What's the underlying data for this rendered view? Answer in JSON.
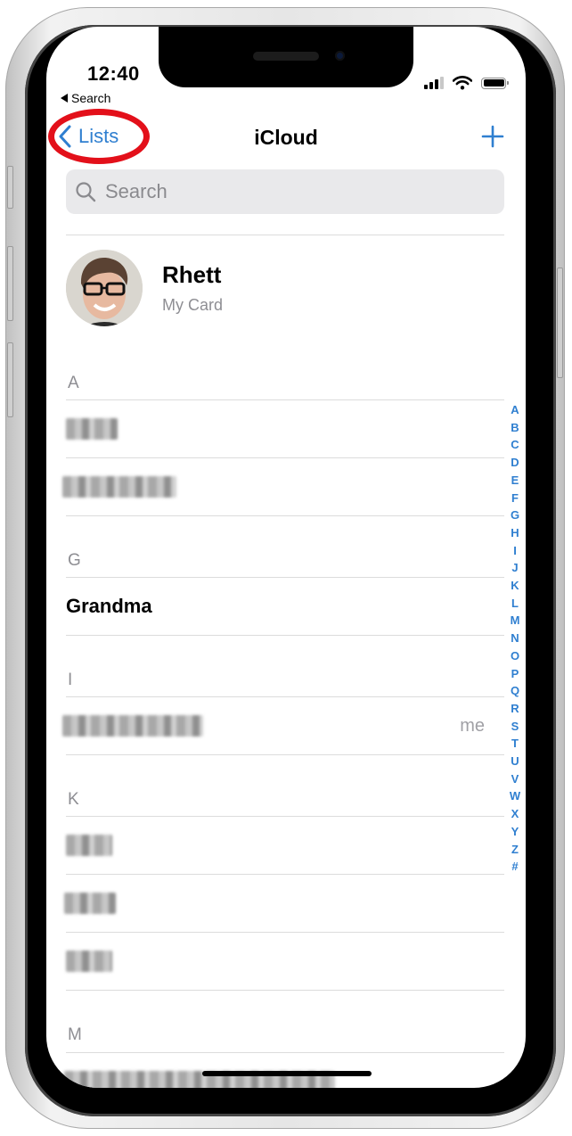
{
  "status_bar": {
    "time": "12:40",
    "back_app": "Search",
    "icons": [
      "cellular-signal-icon",
      "wifi-icon",
      "battery-icon"
    ]
  },
  "nav": {
    "back_label": "Lists",
    "title": "iCloud",
    "add_icon": "plus-icon"
  },
  "search": {
    "placeholder": "Search",
    "value": ""
  },
  "my_card": {
    "name": "Rhett",
    "subtitle": "My Card"
  },
  "sections": [
    {
      "letter": "A",
      "contacts": [
        {
          "name": "[redacted]"
        },
        {
          "name": "[redacted]"
        }
      ]
    },
    {
      "letter": "G",
      "contacts": [
        {
          "name": "Grandma"
        }
      ]
    },
    {
      "letter": "I",
      "contacts": [
        {
          "name": "[redacted]",
          "tag": "me"
        }
      ]
    },
    {
      "letter": "K",
      "contacts": [
        {
          "name": "[redacted]"
        },
        {
          "name": "[redacted]"
        },
        {
          "name": "[redacted]"
        }
      ]
    },
    {
      "letter": "M",
      "contacts": [
        {
          "name": "[redacted]"
        }
      ]
    }
  ],
  "index_letters": [
    "A",
    "B",
    "C",
    "D",
    "E",
    "F",
    "G",
    "H",
    "I",
    "J",
    "K",
    "L",
    "M",
    "N",
    "O",
    "P",
    "Q",
    "R",
    "S",
    "T",
    "U",
    "V",
    "W",
    "X",
    "Y",
    "Z",
    "#"
  ],
  "colors": {
    "accent": "#2f7fd0",
    "highlight_ring": "#e3101a",
    "secondary_text": "#8e8e93"
  }
}
